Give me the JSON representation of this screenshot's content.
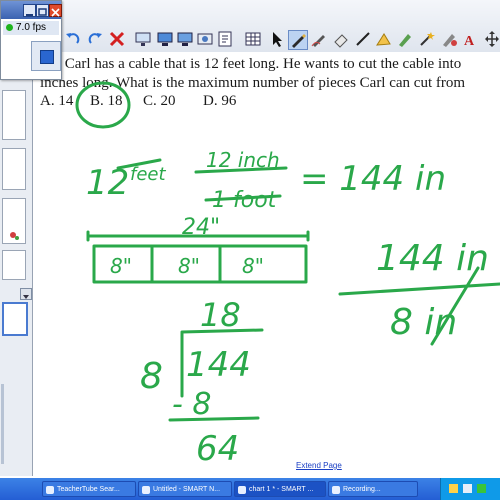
{
  "recorder": {
    "fps": "7.0 fps"
  },
  "question": {
    "line1": ") Carl has a cable that is 12 feet long. He wants to cut the cable into",
    "line2": "inches long. What is the maximum number of pieces Carl can cut from",
    "options": [
      "A. 14",
      "B. 18",
      "C.   20",
      "D.  96"
    ]
  },
  "handwriting": {
    "conv_12": "12",
    "conv_feet": "feet",
    "conv_12inch": "12 inch",
    "conv_1foot": "1 foot",
    "conv_result": "= 144 in",
    "length_label": "24\"",
    "segment_labels": [
      "8\"",
      "8\"",
      "8\""
    ],
    "div_quotient": "18",
    "div_divisor": "8",
    "div_dividend": "144",
    "div_subtract": "- 8",
    "div_remainder": "64",
    "frac_top": "144 in",
    "frac_bottom": "8 in"
  },
  "page": {
    "extend_label": "Extend Page"
  },
  "taskbar": {
    "items": [
      "TeacherTube Sear...",
      "Untitled - SMART N...",
      "chart 1 * - SMART ...",
      "Recording..."
    ]
  },
  "colors": {
    "ink": "#2aa84a",
    "accent": "#2a66d0"
  }
}
